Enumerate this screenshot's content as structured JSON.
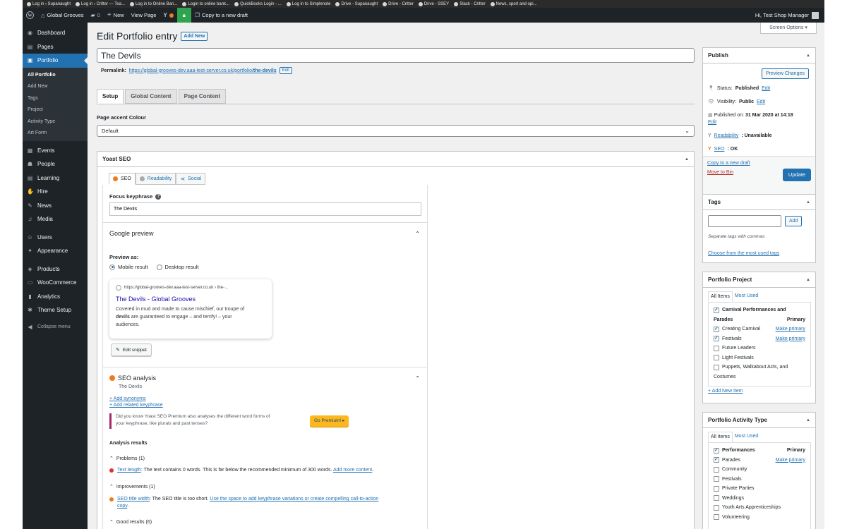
{
  "bookmarks": [
    "Log in ‹ Supanaught",
    "Log in ‹ Critter — Tea...",
    "Log in to Online Ban...",
    "Login to online bank...",
    "QuickBooks Login - ...",
    "Log in to Simplenote",
    "Drive - Supanaught",
    "Drive - Critter",
    "Drive - SSEY",
    "Slack - Critter",
    "News, sport and opi..."
  ],
  "adminbar": {
    "site_name": "Global Grooves",
    "comments_count": "0",
    "new_label": "New",
    "view_page": "View Page",
    "copy_draft": "Copy to a new draft",
    "greeting": "Hi, Test Shop Manager"
  },
  "sidebar": {
    "items": [
      {
        "label": "Dashboard",
        "icon": "dashboard-icon",
        "glyph": "◉"
      },
      {
        "label": "Pages",
        "icon": "pages-icon",
        "glyph": "▤"
      },
      {
        "label": "Portfolio",
        "icon": "portfolio-icon",
        "glyph": "▣"
      }
    ],
    "submenu": [
      "All Portfolio",
      "Add New",
      "Tags",
      "Project",
      "Activity Type",
      "Art Form"
    ],
    "items2": [
      {
        "label": "Events",
        "icon": "calendar-icon",
        "glyph": "▦"
      },
      {
        "label": "People",
        "icon": "people-icon",
        "glyph": "☗"
      },
      {
        "label": "Learning",
        "icon": "learning-icon",
        "glyph": "▤"
      },
      {
        "label": "Hire",
        "icon": "thumbs-up-icon",
        "glyph": "✋"
      },
      {
        "label": "News",
        "icon": "pin-icon",
        "glyph": "✎"
      },
      {
        "label": "Media",
        "icon": "media-icon",
        "glyph": "♫"
      }
    ],
    "items3": [
      {
        "label": "Users",
        "icon": "users-icon",
        "glyph": "☺"
      },
      {
        "label": "Appearance",
        "icon": "appearance-icon",
        "glyph": "✦"
      }
    ],
    "items4": [
      {
        "label": "Products",
        "icon": "products-icon",
        "glyph": "◈"
      },
      {
        "label": "WooCommerce",
        "icon": "woocommerce-icon",
        "glyph": "▭"
      },
      {
        "label": "Analytics",
        "icon": "analytics-icon",
        "glyph": "▮"
      },
      {
        "label": "Theme Setup",
        "icon": "gear-icon",
        "glyph": "✱"
      }
    ],
    "collapse": "Collapse menu"
  },
  "page": {
    "title": "Edit Portfolio entry",
    "add_new": "Add New",
    "screen_options": "Screen Options ▾",
    "post_title": "The Devils",
    "permalink_label": "Permalink:",
    "permalink_base": "https://global-grooves-dev.aaa-test-server.co.uk/portfolio/",
    "permalink_slug": "the-devils",
    "edit": "Edit",
    "tabs": [
      "Setup",
      "Global Content",
      "Page Content"
    ],
    "accent_label": "Page accent Colour",
    "accent_value": "Default"
  },
  "yoast": {
    "title": "Yoast SEO",
    "tabs": [
      "SEO",
      "Readability",
      "Social"
    ],
    "focus_label": "Focus keyphrase",
    "focus_value": "The Devils",
    "google_preview": "Google preview",
    "preview_as": "Preview as:",
    "mobile": "Mobile result",
    "desktop": "Desktop result",
    "snippet_url": "https://global-grooves-dev.aaa-test-server.co.uk › the-...",
    "snippet_title": "The Devils - Global Grooves",
    "snippet_desc_1": "Covered in mud and made to cause mischief, our troupe of",
    "snippet_desc_bold": "devils",
    "snippet_desc_2": " are guaranteed to engage – and terrify! – your",
    "snippet_desc_3": "audiences.",
    "edit_snippet": "Edit snippet",
    "seo_analysis": "SEO analysis",
    "seo_analysis_sub": "The Devils",
    "add_synonyms": "+ Add synonyms",
    "add_related": "+ Add related keyphrase",
    "premium_text_1": "Did you know Yoast SEO Premium also analyses the different word forms of",
    "premium_text_2": "your keyphrase, like plurals and past tenses?",
    "go_premium": "Go Premium! ▸",
    "analysis_results": "Analysis results",
    "problems": "Problems (1)",
    "problem_link": "Text length",
    "problem_text": ": The text contains 0 words. This is far below the recommended minimum of 300 words. ",
    "problem_action": "Add more content",
    "improvements": "Improvements (1)",
    "improve_link": "SEO title width",
    "improve_text": ": The SEO title is too short. ",
    "improve_action_1": "Use the space to add keyphrase variations or create compelling call-to-action",
    "improve_action_2": "copy",
    "good_results": "Good results (6)",
    "colors": {
      "problem": "#dc3232",
      "improvement": "#ee7c1b",
      "good": "#7ad03a",
      "premium": "#ffb81c"
    }
  },
  "publish": {
    "title": "Publish",
    "preview": "Preview Changes",
    "status_label": "Status:",
    "status_value": "Published",
    "visibility_label": "Visibility:",
    "visibility_value": "Public",
    "published_on_label": "Published on:",
    "published_on_value": "31 Mar 2020 at 14:18",
    "readability_label": "Readability",
    "readability_value": ": Unavailable",
    "seo_label": "SEO",
    "seo_value": ": OK",
    "edit": "Edit",
    "copy_draft": "Copy to a new draft",
    "move_bin": "Move to Bin",
    "update": "Update"
  },
  "tags": {
    "title": "Tags",
    "add": "Add",
    "hint": "Separate tags with commas",
    "choose": "Choose from the most used tags"
  },
  "project": {
    "title": "Portfolio Project",
    "tab_all": "All Items",
    "tab_most": "Most Used",
    "items": [
      {
        "label": "Carnival Performances and",
        "checked": true,
        "bold": true
      },
      {
        "label": "Parades",
        "checked": null,
        "bold": true,
        "primary": "Primary"
      },
      {
        "label": "Creating Carnival",
        "checked": true,
        "make_primary": "Make primary"
      },
      {
        "label": "Festivals",
        "checked": true,
        "make_primary": "Make primary"
      },
      {
        "label": "Future Leaders",
        "checked": false
      },
      {
        "label": "Light Festivals",
        "checked": false
      },
      {
        "label": "Puppets, Walkabout Acts, and",
        "checked": false
      },
      {
        "label": "Costumes",
        "checked": null
      }
    ],
    "add_new": "+ Add New Item"
  },
  "activity": {
    "title": "Portfolio Activity Type",
    "tab_all": "All Items",
    "tab_most": "Most Used",
    "items": [
      {
        "label": "Performances",
        "checked": true,
        "bold": true,
        "primary": "Primary"
      },
      {
        "label": "Parades",
        "checked": true,
        "make_primary": "Make primary"
      },
      {
        "label": "Community",
        "checked": false
      },
      {
        "label": "Festivals",
        "checked": false
      },
      {
        "label": "Private Parties",
        "checked": false
      },
      {
        "label": "Weddings",
        "checked": false
      },
      {
        "label": "Youth Arts Apprenticeships",
        "checked": false
      },
      {
        "label": "Volunteering",
        "checked": false
      }
    ]
  }
}
